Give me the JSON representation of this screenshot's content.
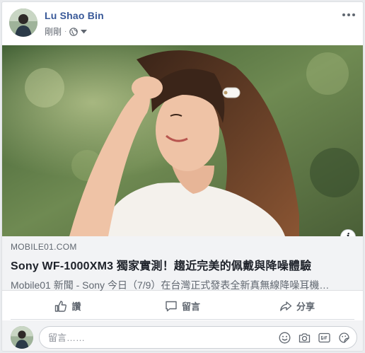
{
  "post": {
    "author": "Lu Shao Bin",
    "timestamp": "剛剛",
    "separator": "·",
    "privacy_icon": "globe-icon",
    "menu_icon": "more-icon"
  },
  "link": {
    "image_alt": "Woman wearing Sony wireless earbuds",
    "domain": "MOBILE01.COM",
    "title": "Sony WF-1000XM3 獨家實測！趨近完美的佩戴與降噪體驗",
    "description": "Mobile01 新聞 - Sony 今日（7/9）在台灣正式發表全新真無線降噪耳機…",
    "info_label": "i"
  },
  "actions": {
    "like_label": "讚",
    "comment_label": "留言",
    "share_label": "分享"
  },
  "comment_box": {
    "placeholder": "留言……",
    "tools": [
      "emoji-icon",
      "camera-icon",
      "gif-icon",
      "sticker-icon"
    ]
  },
  "colors": {
    "author_link": "#385898",
    "muted_text": "#606770",
    "card_bg": "#ffffff",
    "preview_bg": "#f2f3f5"
  }
}
